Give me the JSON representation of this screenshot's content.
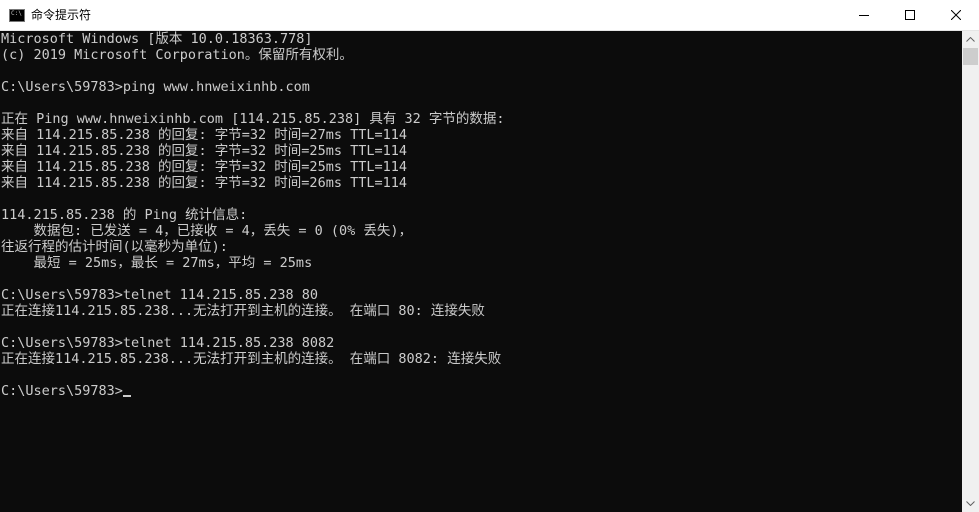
{
  "window": {
    "title": "命令提示符",
    "icon": "cmd-icon",
    "icon_glyph": "C:\\"
  },
  "console": {
    "lines": [
      "Microsoft Windows [版本 10.0.18363.778]",
      "(c) 2019 Microsoft Corporation。保留所有权利。",
      "",
      "C:\\Users\\59783>ping www.hnweixinhb.com",
      "",
      "正在 Ping www.hnweixinhb.com [114.215.85.238] 具有 32 字节的数据:",
      "来自 114.215.85.238 的回复: 字节=32 时间=27ms TTL=114",
      "来自 114.215.85.238 的回复: 字节=32 时间=25ms TTL=114",
      "来自 114.215.85.238 的回复: 字节=32 时间=25ms TTL=114",
      "来自 114.215.85.238 的回复: 字节=32 时间=26ms TTL=114",
      "",
      "114.215.85.238 的 Ping 统计信息:",
      "    数据包: 已发送 = 4，已接收 = 4，丢失 = 0 (0% 丢失)，",
      "往返行程的估计时间(以毫秒为单位):",
      "    最短 = 25ms，最长 = 27ms，平均 = 25ms",
      "",
      "C:\\Users\\59783>telnet 114.215.85.238 80",
      "正在连接114.215.85.238...无法打开到主机的连接。 在端口 80: 连接失败",
      "",
      "C:\\Users\\59783>telnet 114.215.85.238 8082",
      "正在连接114.215.85.238...无法打开到主机的连接。 在端口 8082: 连接失败",
      "",
      "C:\\Users\\59783>"
    ]
  },
  "colors": {
    "console_bg": "#0c0c0c",
    "console_fg": "#cccccc",
    "titlebar_bg": "#ffffff"
  }
}
